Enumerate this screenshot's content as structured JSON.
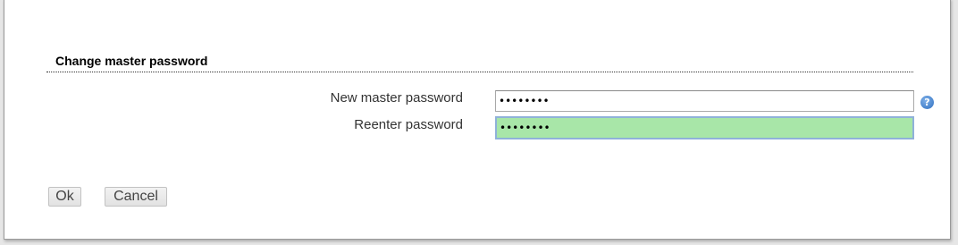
{
  "dialog": {
    "section_title": "Change master password",
    "fields": {
      "new_password": {
        "label": "New master password",
        "value": "••••••••",
        "background": "#ffffff"
      },
      "reenter_password": {
        "label": "Reenter password",
        "value": "••••••••",
        "background": "#a8e6a8"
      }
    },
    "help_icon": {
      "icon": "help-icon",
      "glyph": "?"
    },
    "buttons": {
      "ok_label": "Ok",
      "cancel_label": "Cancel"
    }
  }
}
